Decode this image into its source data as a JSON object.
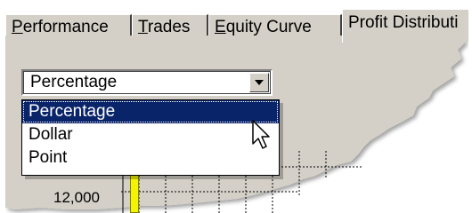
{
  "tabs": [
    {
      "label": "Performance",
      "active": false
    },
    {
      "label": "Trades",
      "active": false
    },
    {
      "label": "Equity Curve",
      "active": false
    },
    {
      "label": "Profit Distributi",
      "active": true
    }
  ],
  "combo": {
    "value": "Percentage",
    "icon": "chevron-down-icon"
  },
  "dropdown": {
    "options": [
      "Percentage",
      "Dollar",
      "Point"
    ],
    "selected_index": 0
  },
  "chart": {
    "y_tick": "12,000",
    "bar_color": "#f4f400"
  },
  "colors": {
    "panel": "#d4d0c8",
    "selection": "#0a246a"
  }
}
